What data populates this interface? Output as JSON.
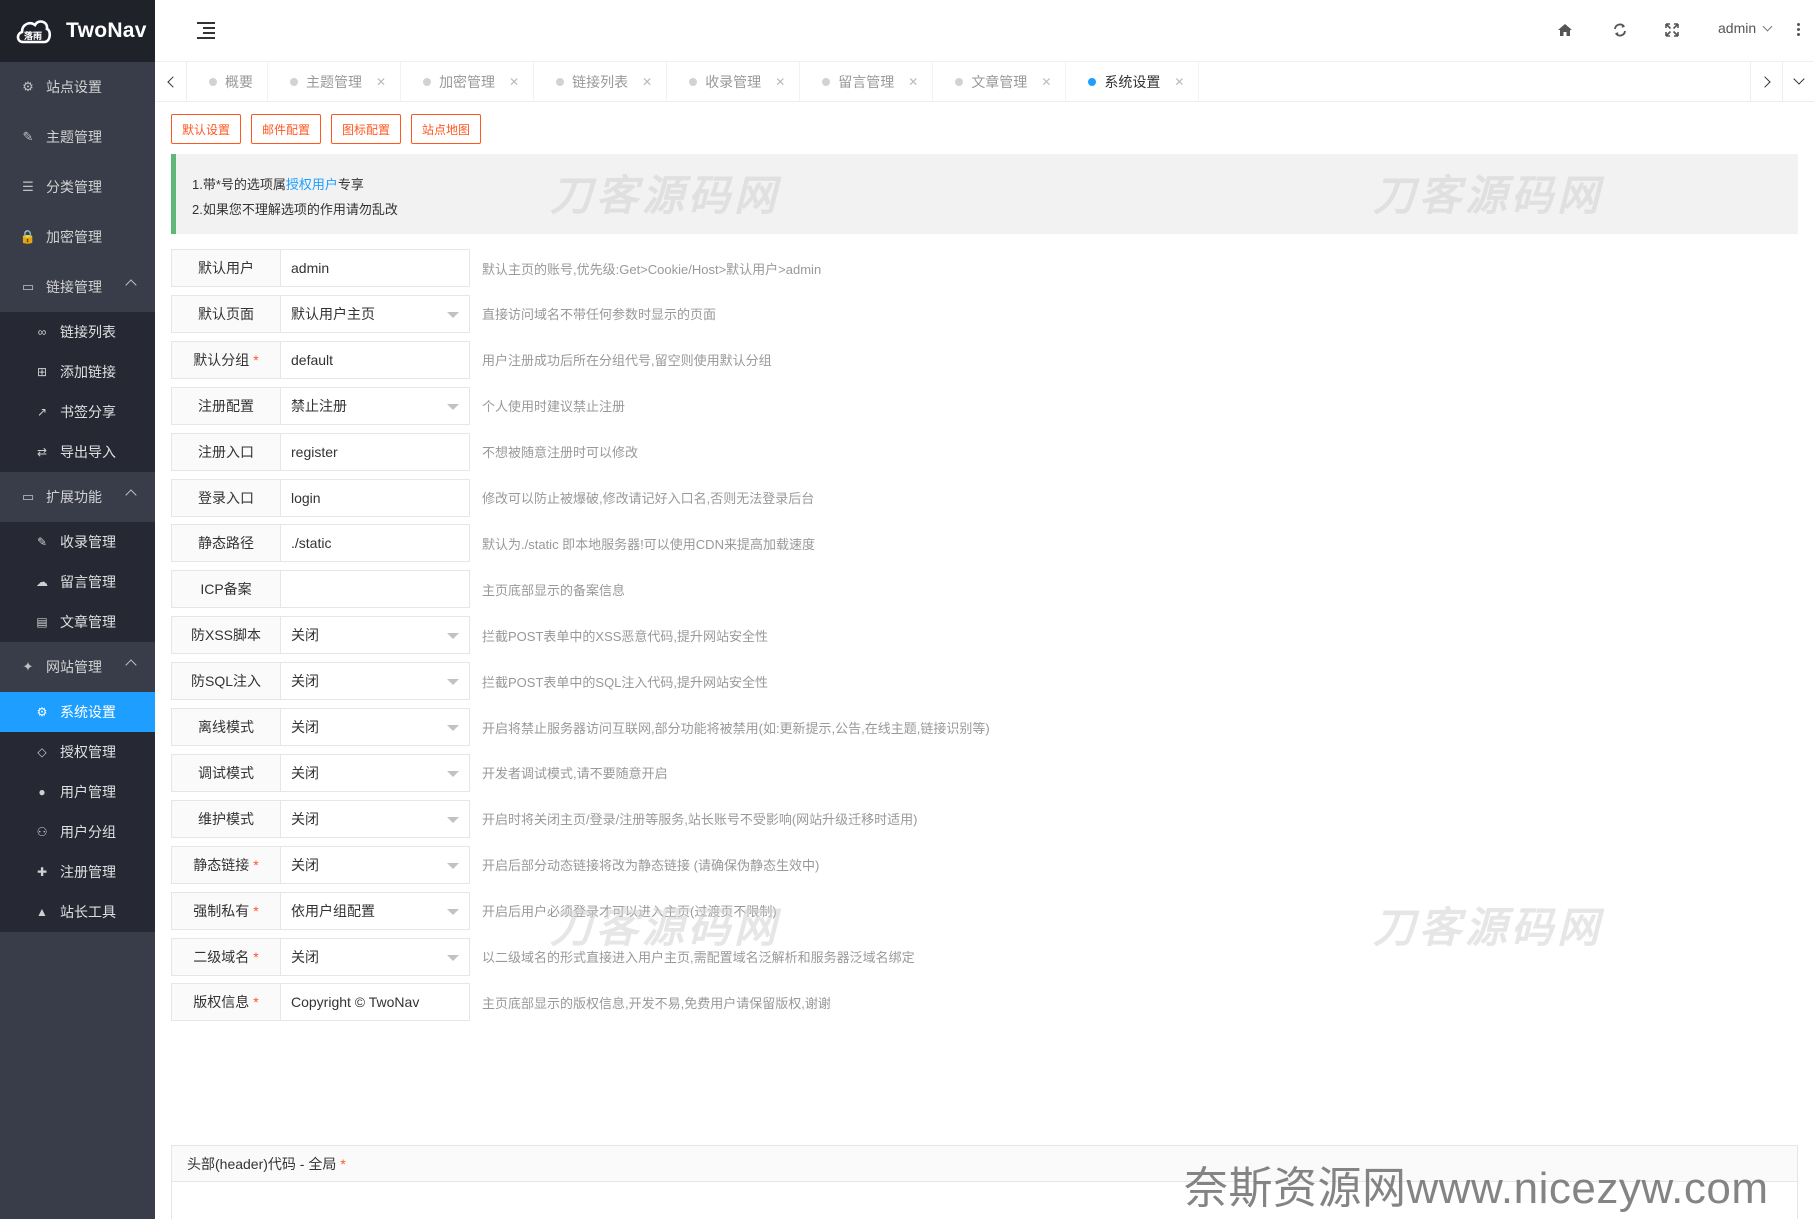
{
  "app": {
    "name": "TwoNav",
    "logo_text": "落雨"
  },
  "sidebar": {
    "items": [
      {
        "label": "站点设置",
        "icon": "gear-icon"
      },
      {
        "label": "主题管理",
        "icon": "magic-wand-icon"
      },
      {
        "label": "分类管理",
        "icon": "list-icon"
      },
      {
        "label": "加密管理",
        "icon": "lock-icon"
      },
      {
        "label": "链接管理",
        "icon": "folder-open-icon",
        "expanded": true,
        "children": [
          {
            "label": "链接列表",
            "icon": "link-icon"
          },
          {
            "label": "添加链接",
            "icon": "plus-square-icon"
          },
          {
            "label": "书签分享",
            "icon": "share-icon"
          },
          {
            "label": "导出导入",
            "icon": "exchange-icon"
          }
        ]
      },
      {
        "label": "扩展功能",
        "icon": "folder-open-icon",
        "expanded": true,
        "children": [
          {
            "label": "收录管理",
            "icon": "pencil-icon"
          },
          {
            "label": "留言管理",
            "icon": "comment-icon"
          },
          {
            "label": "文章管理",
            "icon": "file-text-icon"
          }
        ]
      },
      {
        "label": "网站管理",
        "icon": "wrench-icon",
        "expanded": true,
        "children": [
          {
            "label": "系统设置",
            "icon": "cogs-icon",
            "active": true
          },
          {
            "label": "授权管理",
            "icon": "diamond-icon"
          },
          {
            "label": "用户管理",
            "icon": "user-icon"
          },
          {
            "label": "用户分组",
            "icon": "users-icon"
          },
          {
            "label": "注册管理",
            "icon": "user-plus-icon"
          },
          {
            "label": "站长工具",
            "icon": "warning-icon"
          }
        ]
      }
    ]
  },
  "header": {
    "user": "admin"
  },
  "tabs": [
    {
      "label": "概要",
      "closable": false,
      "active": false
    },
    {
      "label": "主题管理",
      "closable": true,
      "active": false
    },
    {
      "label": "加密管理",
      "closable": true,
      "active": false
    },
    {
      "label": "链接列表",
      "closable": true,
      "active": false
    },
    {
      "label": "收录管理",
      "closable": true,
      "active": false
    },
    {
      "label": "留言管理",
      "closable": true,
      "active": false
    },
    {
      "label": "文章管理",
      "closable": true,
      "active": false
    },
    {
      "label": "系统设置",
      "closable": true,
      "active": true
    }
  ],
  "subtabs": [
    "默认设置",
    "邮件配置",
    "图标配置",
    "站点地图"
  ],
  "notice": {
    "line1_prefix": "1.带*号的选项属",
    "line1_link": "授权用户",
    "line1_suffix": "专享",
    "line2": "2.如果您不理解选项的作用请勿乱改"
  },
  "watermark_text": "刀客源码网",
  "form": [
    {
      "label": "默认用户",
      "required": false,
      "type": "input",
      "value": "admin",
      "hint": "默认主页的账号,优先级:Get>Cookie/Host>默认用户>admin"
    },
    {
      "label": "默认页面",
      "required": false,
      "type": "select",
      "value": "默认用户主页",
      "hint": "直接访问域名不带任何参数时显示的页面"
    },
    {
      "label": "默认分组",
      "required": true,
      "type": "input",
      "value": "default",
      "hint": "用户注册成功后所在分组代号,留空则使用默认分组"
    },
    {
      "label": "注册配置",
      "required": false,
      "type": "select",
      "value": "禁止注册",
      "hint": "个人使用时建议禁止注册"
    },
    {
      "label": "注册入口",
      "required": false,
      "type": "input",
      "value": "register",
      "hint": "不想被随意注册时可以修改"
    },
    {
      "label": "登录入口",
      "required": false,
      "type": "input",
      "value": "login",
      "hint": "修改可以防止被爆破,修改请记好入口名,否则无法登录后台"
    },
    {
      "label": "静态路径",
      "required": false,
      "type": "input",
      "value": "./static",
      "hint": "默认为./static 即本地服务器!可以使用CDN来提高加载速度"
    },
    {
      "label": "ICP备案",
      "required": false,
      "type": "input",
      "value": "",
      "hint": "主页底部显示的备案信息"
    },
    {
      "label": "防XSS脚本",
      "required": false,
      "type": "select",
      "value": "关闭",
      "hint": "拦截POST表单中的XSS恶意代码,提升网站安全性"
    },
    {
      "label": "防SQL注入",
      "required": false,
      "type": "select",
      "value": "关闭",
      "hint": "拦截POST表单中的SQL注入代码,提升网站安全性"
    },
    {
      "label": "离线模式",
      "required": false,
      "type": "select",
      "value": "关闭",
      "hint": "开启将禁止服务器访问互联网,部分功能将被禁用(如:更新提示,公告,在线主题,链接识别等)"
    },
    {
      "label": "调试模式",
      "required": false,
      "type": "select",
      "value": "关闭",
      "hint": "开发者调试模式,请不要随意开启"
    },
    {
      "label": "维护模式",
      "required": false,
      "type": "select",
      "value": "关闭",
      "hint": "开启时将关闭主页/登录/注册等服务,站长账号不受影响(网站升级迁移时适用)"
    },
    {
      "label": "静态链接",
      "required": true,
      "type": "select",
      "value": "关闭",
      "hint": "开启后部分动态链接将改为静态链接 (请确保伪静态生效中)"
    },
    {
      "label": "强制私有",
      "required": true,
      "type": "select",
      "value": "依用户组配置",
      "hint": "开启后用户必须登录才可以进入主页(过渡页不限制)"
    },
    {
      "label": "二级域名",
      "required": true,
      "type": "select",
      "value": "关闭",
      "hint": "以二级域名的形式直接进入用户主页,需配置域名泛解析和服务器泛域名绑定"
    },
    {
      "label": "版权信息",
      "required": true,
      "type": "input",
      "value": "Copyright © TwoNav",
      "hint": "主页底部显示的版权信息,开发不易,免费用户请保留版权,谢谢"
    }
  ],
  "code_panel": {
    "title": "头部(header)代码 - 全局"
  },
  "site_watermark": "奈斯资源网www.nicezyw.com",
  "colors": {
    "accent": "#1e9fff",
    "sidebar": "#393d49",
    "subtab": "#ff5722",
    "notice_border": "#5fb878"
  }
}
